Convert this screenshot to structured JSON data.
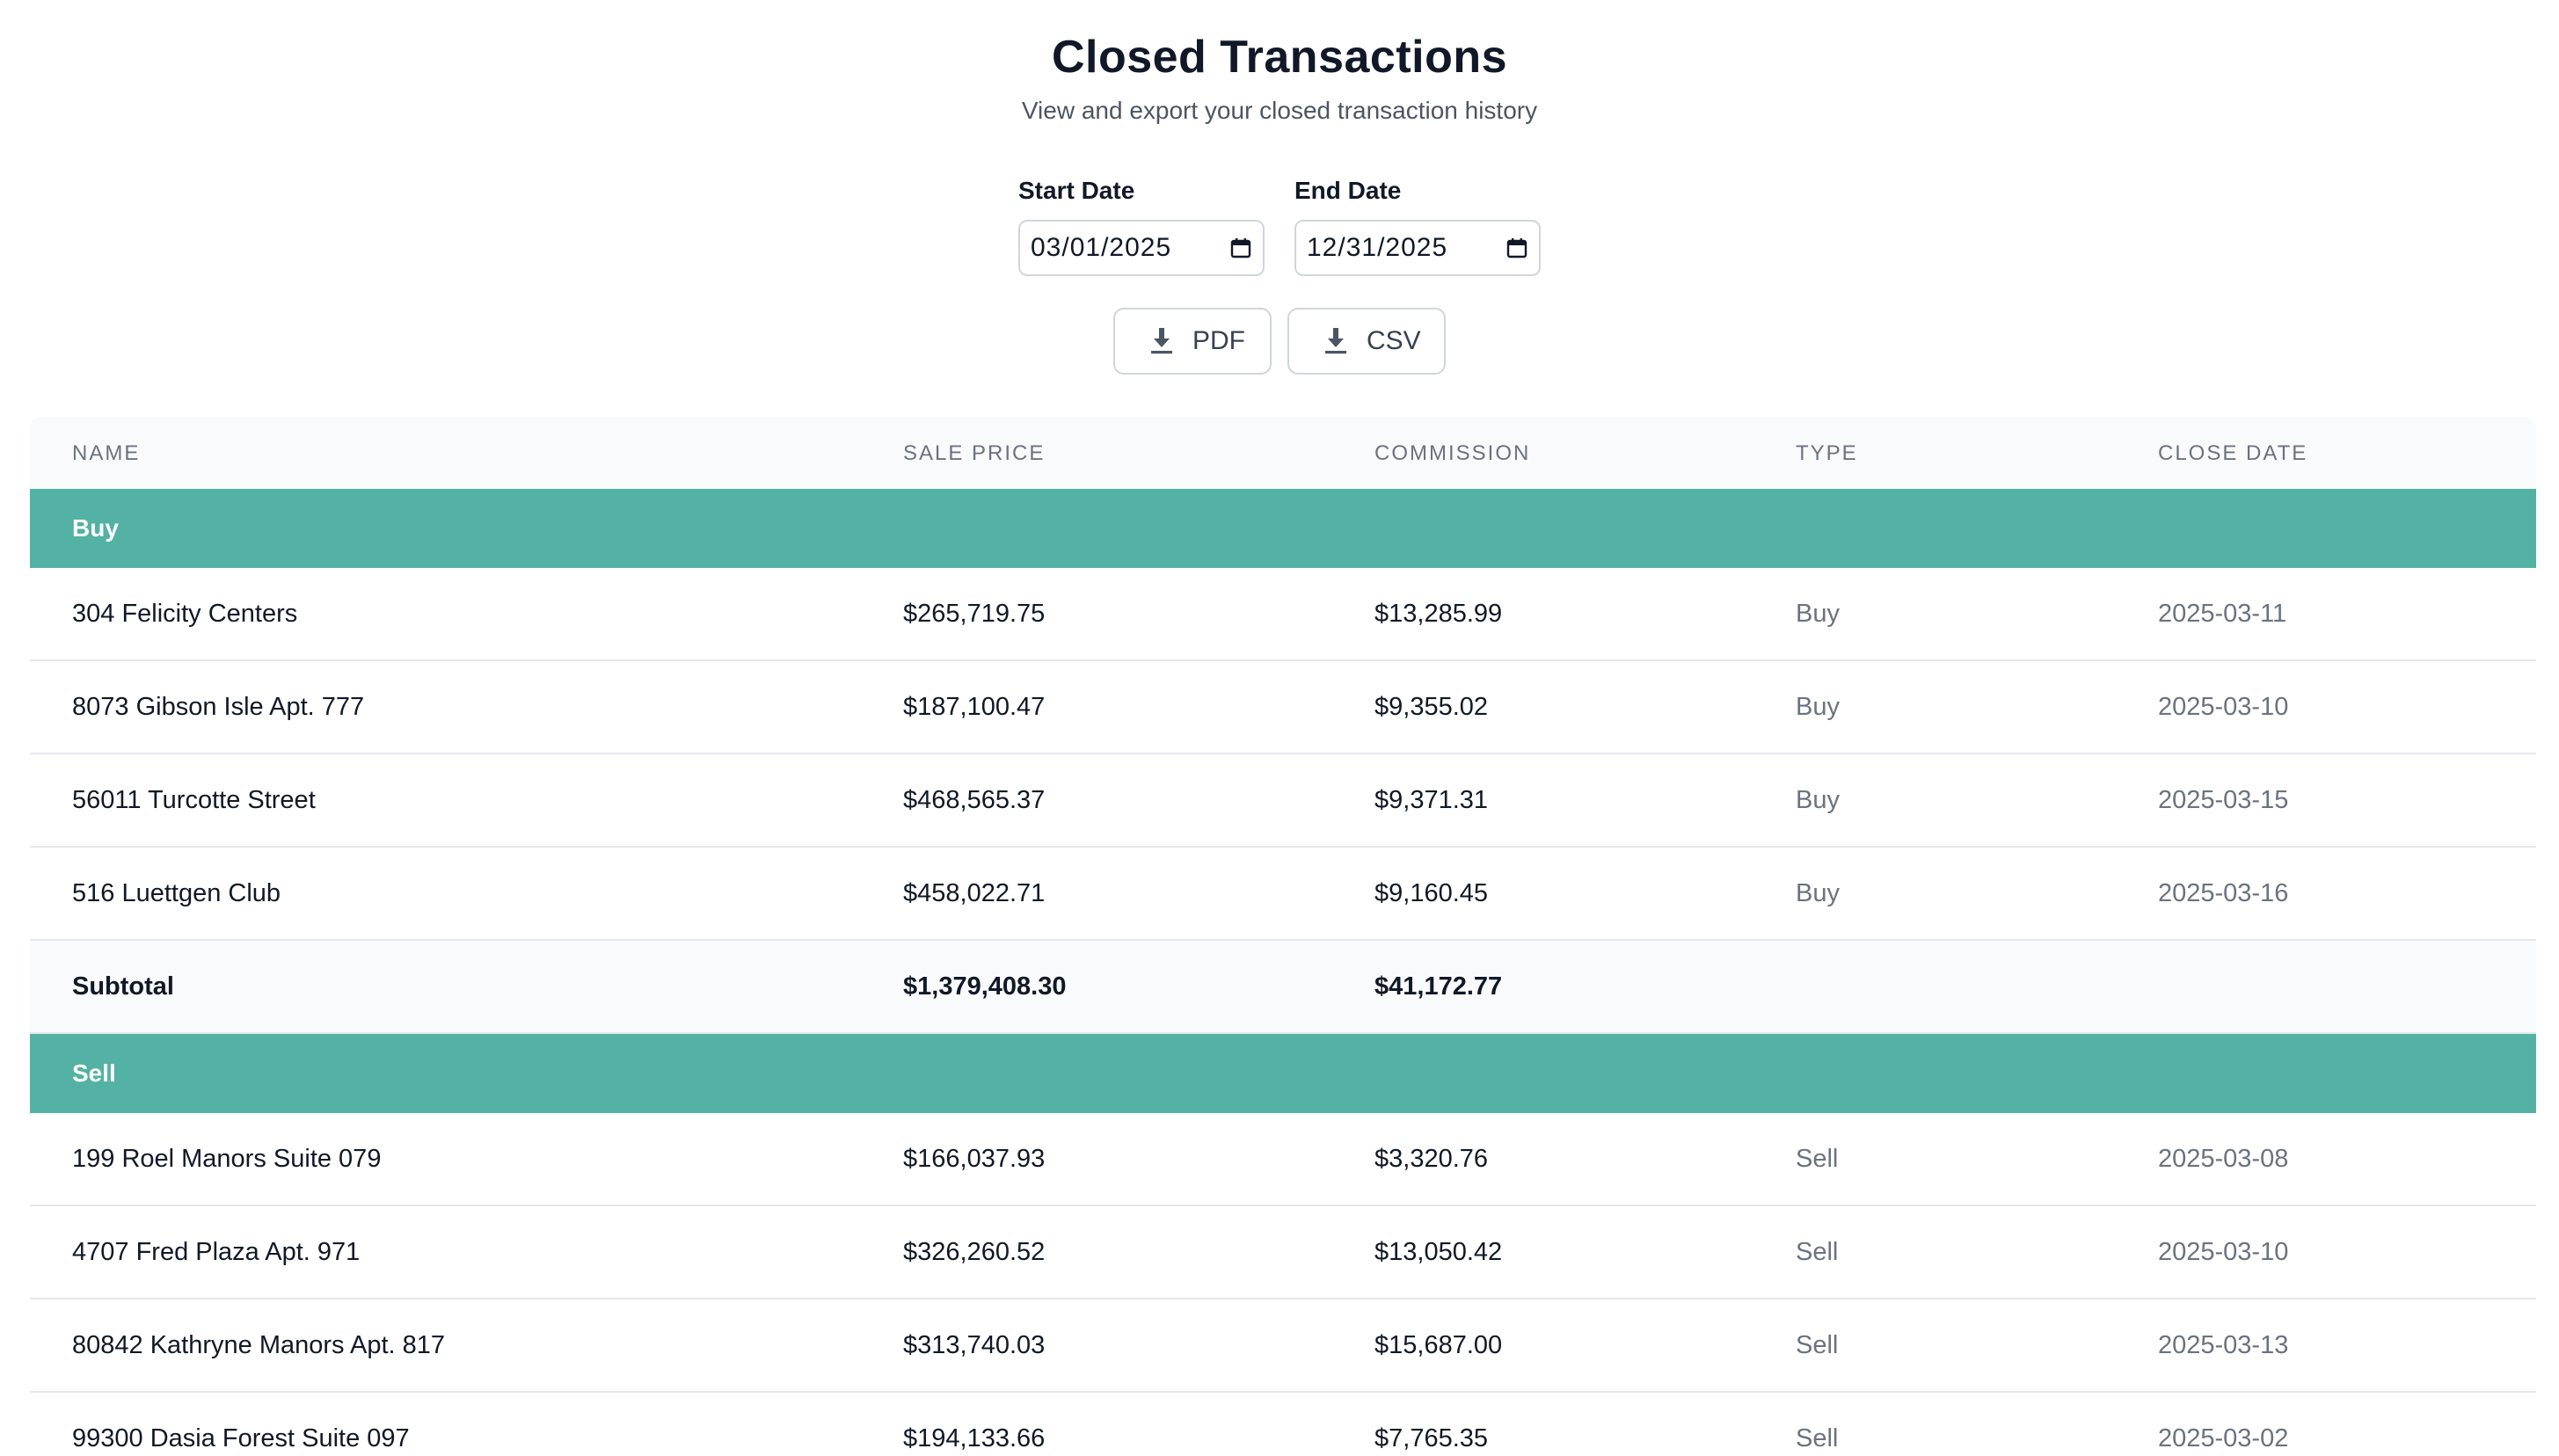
{
  "header": {
    "title": "Closed Transactions",
    "subtitle": "View and export your closed transaction history"
  },
  "filters": {
    "start_label": "Start Date",
    "start_value": "03/01/2025",
    "end_label": "End Date",
    "end_value": "12/31/2025"
  },
  "actions": {
    "pdf_label": "PDF",
    "csv_label": "CSV"
  },
  "table": {
    "columns": [
      "Name",
      "Sale Price",
      "Commission",
      "Type",
      "Close Date"
    ],
    "groups": [
      {
        "label": "Buy",
        "rows": [
          {
            "name": "304 Felicity Centers",
            "price": "$265,719.75",
            "commission": "$13,285.99",
            "type": "Buy",
            "date": "2025-03-11"
          },
          {
            "name": "8073 Gibson Isle Apt. 777",
            "price": "$187,100.47",
            "commission": "$9,355.02",
            "type": "Buy",
            "date": "2025-03-10"
          },
          {
            "name": "56011 Turcotte Street",
            "price": "$468,565.37",
            "commission": "$9,371.31",
            "type": "Buy",
            "date": "2025-03-15"
          },
          {
            "name": "516 Luettgen Club",
            "price": "$458,022.71",
            "commission": "$9,160.45",
            "type": "Buy",
            "date": "2025-03-16"
          }
        ],
        "subtotal": {
          "label": "Subtotal",
          "price": "$1,379,408.30",
          "commission": "$41,172.77"
        }
      },
      {
        "label": "Sell",
        "rows": [
          {
            "name": "199 Roel Manors Suite 079",
            "price": "$166,037.93",
            "commission": "$3,320.76",
            "type": "Sell",
            "date": "2025-03-08"
          },
          {
            "name": "4707 Fred Plaza Apt. 971",
            "price": "$326,260.52",
            "commission": "$13,050.42",
            "type": "Sell",
            "date": "2025-03-10"
          },
          {
            "name": "80842 Kathryne Manors Apt. 817",
            "price": "$313,740.03",
            "commission": "$15,687.00",
            "type": "Sell",
            "date": "2025-03-13"
          },
          {
            "name": "99300 Dasia Forest Suite 097",
            "price": "$194,133.66",
            "commission": "$7,765.35",
            "type": "Sell",
            "date": "2025-03-02"
          }
        ]
      }
    ]
  },
  "colors": {
    "group_bg": "#53b2a3",
    "header_bg": "#f9fafb",
    "border": "#e5e7eb"
  },
  "icons": {
    "calendar": "calendar-icon",
    "download": "download-icon"
  }
}
